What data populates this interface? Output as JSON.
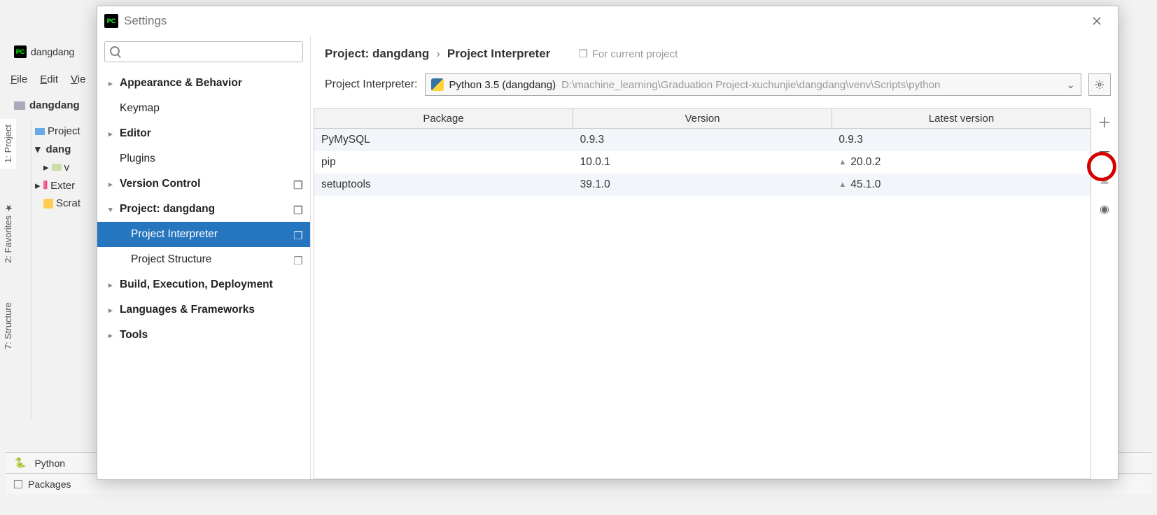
{
  "ide": {
    "title": "dangdang",
    "menus": [
      "File",
      "Edit",
      "Vie"
    ],
    "crumb": "dangdang",
    "left_tabs": {
      "project": "1: Project",
      "favorites": "2: Favorites",
      "structure": "7: Structure"
    },
    "tree": {
      "row0": "Project",
      "row1": "dang",
      "row2": "v",
      "row3": "Exter",
      "row4": "Scrat"
    },
    "status_python": "Python",
    "status_packages": "Packages"
  },
  "settings": {
    "title": "Settings",
    "search_placeholder": "",
    "nav": {
      "appearance": "Appearance & Behavior",
      "keymap": "Keymap",
      "editor": "Editor",
      "plugins": "Plugins",
      "version_control": "Version Control",
      "project": "Project: dangdang",
      "project_interpreter": "Project Interpreter",
      "project_structure": "Project Structure",
      "build": "Build, Execution, Deployment",
      "languages": "Languages & Frameworks",
      "tools": "Tools"
    },
    "breadcrumb": {
      "a": "Project: dangdang",
      "b": "Project Interpreter"
    },
    "hint": "For current project",
    "interpreter_label": "Project Interpreter:",
    "interpreter_name": "Python 3.5 (dangdang)",
    "interpreter_path": "D:\\machine_learning\\Graduation Project-xuchunjie\\dangdang\\venv\\Scripts\\python",
    "headers": {
      "pkg": "Package",
      "ver": "Version",
      "latest": "Latest version"
    },
    "packages": [
      {
        "name": "PyMySQL",
        "version": "0.9.3",
        "latest": "0.9.3",
        "upgrade": false
      },
      {
        "name": "pip",
        "version": "10.0.1",
        "latest": "20.0.2",
        "upgrade": true
      },
      {
        "name": "setuptools",
        "version": "39.1.0",
        "latest": "45.1.0",
        "upgrade": true
      }
    ]
  }
}
